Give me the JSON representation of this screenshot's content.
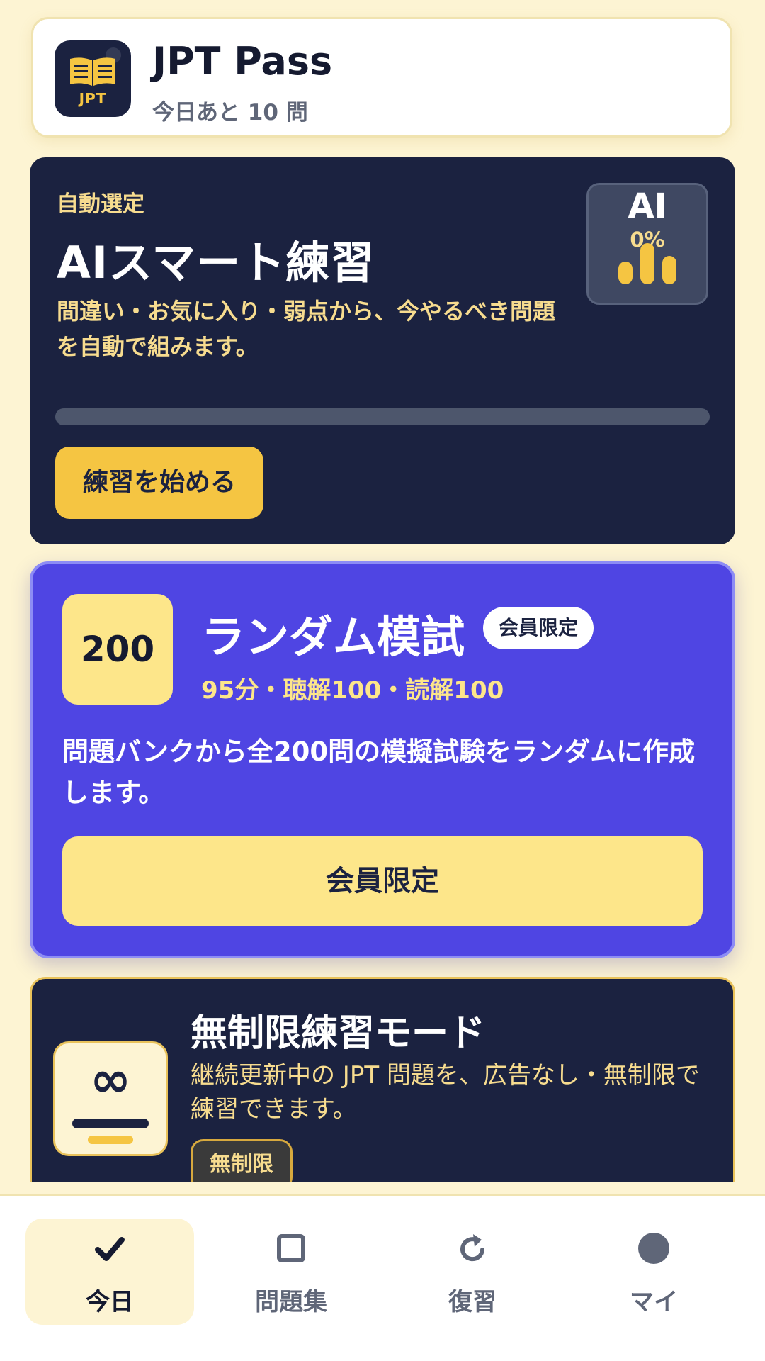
{
  "header": {
    "app_logo_text": "JPT",
    "title": "JPT Pass",
    "subtitle": "今日あと 10 問"
  },
  "ai_practice": {
    "eyebrow": "自動選定",
    "title": "AIスマート練習",
    "description": "間違い・お気に入り・弱点から、今やるべき問題を自動で組みます。",
    "badge_label": "AI",
    "badge_percent": "0%",
    "progress_fraction": 0,
    "start_button": "練習を始める"
  },
  "random_mock": {
    "tile_number": "200",
    "title": "ランダム模試",
    "badge": "会員限定",
    "meta": "95分・聴解100・読解100",
    "description": "問題バンクから全200問の模擬試験をランダムに作成します。",
    "button": "会員限定"
  },
  "unlimited": {
    "title": "無制限練習モード",
    "description": "継続更新中の JPT 問題を、広告なし・無制限で練習できます。",
    "tag": "無制限",
    "icon_glyph": "∞"
  },
  "tabbar": {
    "tabs": [
      {
        "label": "今日",
        "icon": "check-icon",
        "active": true
      },
      {
        "label": "問題集",
        "icon": "square-icon",
        "active": false
      },
      {
        "label": "復習",
        "icon": "refresh-icon",
        "active": false
      },
      {
        "label": "マイ",
        "icon": "profile-circle-icon",
        "active": false
      }
    ]
  },
  "colors": {
    "background": "#fdf4d3",
    "navy": "#1b2240",
    "accent_yellow": "#f5c542",
    "light_yellow": "#fde68a",
    "indigo": "#4f45e3"
  }
}
